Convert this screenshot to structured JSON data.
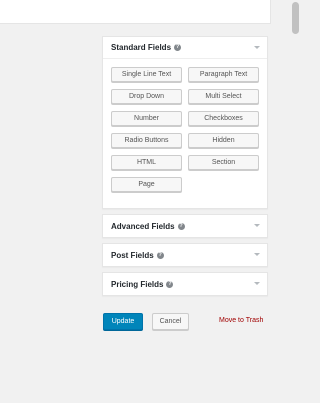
{
  "standard_fields": {
    "title": "Standard Fields",
    "help_glyph": "?",
    "buttons": [
      "Single Line Text",
      "Paragraph Text",
      "Drop Down",
      "Multi Select",
      "Number",
      "Checkboxes",
      "Radio Buttons",
      "Hidden",
      "HTML",
      "Section",
      "Page"
    ]
  },
  "advanced_fields": {
    "title": "Advanced Fields",
    "help_glyph": "?"
  },
  "post_fields": {
    "title": "Post Fields",
    "help_glyph": "?"
  },
  "pricing_fields": {
    "title": "Pricing Fields",
    "help_glyph": "?"
  },
  "actions": {
    "update_label": "Update",
    "cancel_label": "Cancel",
    "trash_label": "Move to Trash"
  },
  "colors": {
    "primary": "#0085ba",
    "trash": "#a00000",
    "background": "#f1f1f1"
  }
}
